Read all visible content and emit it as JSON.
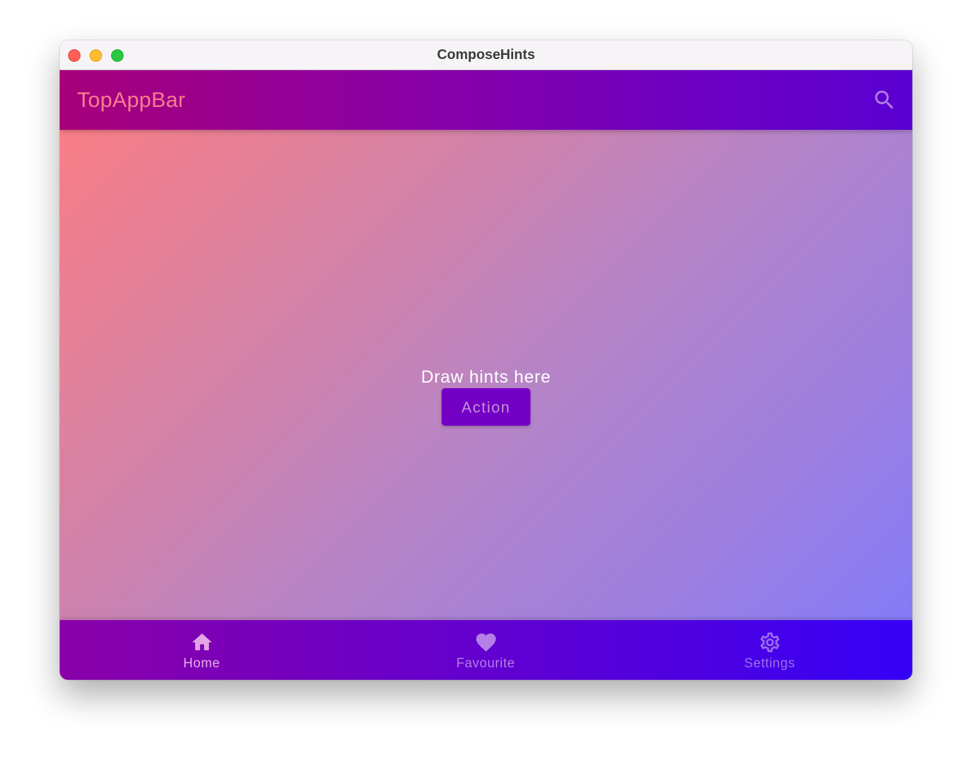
{
  "window": {
    "title": "ComposeHints"
  },
  "top_app_bar": {
    "title": "TopAppBar",
    "action_icon": "search-icon"
  },
  "content": {
    "hint_text": "Draw hints here",
    "action_label": "Action"
  },
  "bottom_nav": {
    "items": [
      {
        "label": "Home",
        "icon": "home-icon"
      },
      {
        "label": "Favourite",
        "icon": "heart-icon"
      },
      {
        "label": "Settings",
        "icon": "gear-icon"
      }
    ]
  },
  "colors": {
    "top_bar_start": "#a7007a",
    "top_bar_end": "#5a00d2",
    "bottom_bar_start": "#8a00a8",
    "bottom_bar_end": "#3500f6",
    "action_button": "#7400c6",
    "title_text": "#f77c8f"
  }
}
